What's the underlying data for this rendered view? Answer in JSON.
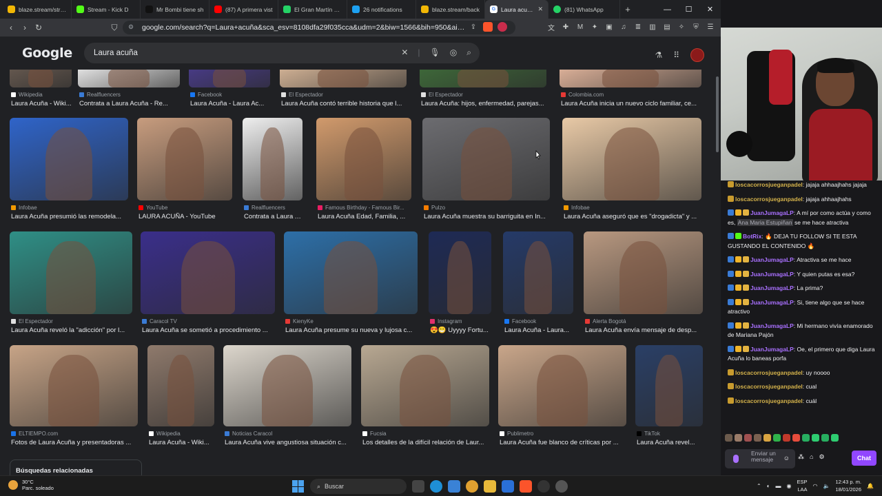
{
  "tabs": [
    {
      "title": "blaze.stream/strea",
      "color": "#f2b705"
    },
    {
      "title": "Stream - Kick D",
      "color": "#53fc18"
    },
    {
      "title": "Mr Bombi tiene sh",
      "color": "#111111"
    },
    {
      "title": "(87) A primera vist",
      "color": "#ff0000"
    },
    {
      "title": "El Gran Martín Eliz",
      "color": "#25d366"
    },
    {
      "title": "26 notifications",
      "color": "#1da1f2"
    },
    {
      "title": "blaze.stream/back",
      "color": "#f2b705"
    }
  ],
  "active_tab": {
    "title": "Laura acuña -",
    "close": "✕"
  },
  "whatsapp_tab": {
    "title": "(81) WhatsApp"
  },
  "new_tab_icon": "+",
  "window_controls": [
    "—",
    "☐",
    "✕"
  ],
  "url": "google.com/search?q=Laura+acuña&sca_esv=8108dfa29f035cca&udm=2&biw=1566&bih=950&aic=0&sxsrf=...",
  "google": {
    "logo": "Google",
    "query": "Laura acuña"
  },
  "rows": [
    [
      {
        "source": "Wikipedia",
        "caption": "Laura Acuña - Wiki...",
        "color": "#6a5c52",
        "sc": "#ffffff"
      },
      {
        "source": "Realfluencers",
        "caption": "Contrata a Laura Acuña - Re...",
        "color": "#efefef",
        "sc": "#3a7bd5"
      },
      {
        "source": "Facebook",
        "caption": "Laura Acuña - Laura Ac...",
        "color": "#4a3c8c",
        "sc": "#1877f2"
      },
      {
        "source": "El Espectador",
        "caption": "Laura Acuña contó terrible historia que l...",
        "color": "#d9b89a",
        "sc": "#e0e0e0"
      },
      {
        "source": "El Espectador",
        "caption": "Laura Acuña: hijos, enfermedad, parejas...",
        "color": "#3f6b3a",
        "sc": "#e0e0e0"
      },
      {
        "source": "Colombia.com",
        "caption": "Laura Acuña inicia un nuevo ciclo familiar, ce...",
        "color": "#e4b79e",
        "sc": "#e53935"
      }
    ],
    [
      {
        "source": "Infobae",
        "caption": "Laura Acuña presumió las remodela...",
        "color": "#2f64c9",
        "sc": "#f29900"
      },
      {
        "source": "YouTube",
        "caption": "LAURA ACUÑA - YouTube",
        "color": "#c79c7e",
        "sc": "#ff0000"
      },
      {
        "source": "Realfluencers",
        "caption": "Contrata a Laura A...",
        "color": "#eeeeee",
        "sc": "#3a7bd5"
      },
      {
        "source": "Famous Birthday - Famous Bir...",
        "caption": "Laura Acuña Edad, Familia, ...",
        "color": "#d19a6c",
        "sc": "#e91e63"
      },
      {
        "source": "Pulzo",
        "caption": "Laura Acuña muestra su barriguita en In...",
        "color": "#6c6c70",
        "sc": "#f57c00"
      },
      {
        "source": "Infobae",
        "caption": "Laura Acuña aseguró que es \"drogadicta\" y ...",
        "color": "#e8c9a6",
        "sc": "#f29900"
      }
    ],
    [
      {
        "source": "El Espectador",
        "caption": "Laura Acuña reveló la \"adicción\" por l...",
        "color": "#2f8f86",
        "sc": "#e0e0e0"
      },
      {
        "source": "Caracol TV",
        "caption": "Laura Acuña se sometió a procedimiento ...",
        "color": "#3a2e8a",
        "sc": "#3a7bd5"
      },
      {
        "source": "KienyKe",
        "caption": "Laura Acuña presume su nueva y lujosa c...",
        "color": "#2d6fa8",
        "sc": "#e53935"
      },
      {
        "source": "Instagram",
        "caption": "😍😁 Uyyyy Fortu...",
        "color": "#1e2a55",
        "sc": "#e1306c"
      },
      {
        "source": "Facebook",
        "caption": "Laura Acuña - Laura...",
        "color": "#253a68",
        "sc": "#1877f2"
      },
      {
        "source": "Alerta Bogotá",
        "caption": "Laura Acuña envía mensaje de desp...",
        "color": "#b89880",
        "sc": "#e53935"
      }
    ],
    [
      {
        "source": "ELTIEMPO.com",
        "caption": "Fotos de Laura Acuña y presentadoras ...",
        "color": "#c7a487",
        "sc": "#1a73e8"
      },
      {
        "source": "Wikipedia",
        "caption": "Laura Acuña - Wiki...",
        "color": "#8f7a6c",
        "sc": "#ffffff"
      },
      {
        "source": "Noticias Caracol",
        "caption": "Laura Acuña vive angustiosa situación c...",
        "color": "#dcd6cc",
        "sc": "#3a7bd5"
      },
      {
        "source": "Fucsia",
        "caption": "Los detalles de la difícil relación de Laur...",
        "color": "#b8a892",
        "sc": "#ffffff"
      },
      {
        "source": "Publimetro",
        "caption": "Laura Acuña fue blanco de críticas por ...",
        "color": "#c9a68a",
        "sc": "#ffffff"
      },
      {
        "source": "TikTok",
        "caption": "Laura Acuña revel...",
        "color": "#2a3f66",
        "sc": "#000000"
      }
    ]
  ],
  "related_label": "Búsquedas relacionadas",
  "taskbar": {
    "temp": "30°C",
    "weather": "Parc. soleado",
    "search": "Buscar",
    "lang1": "ESP",
    "lang2": "LAA",
    "time": "12:43 p. m.",
    "date": "18/01/2026"
  },
  "chat": {
    "messages": [
      {
        "user": "loscacorrosjueganpadel",
        "color": "#d4b24b",
        "text": ": jajaja ahhaajhahs jajaja",
        "badges": [
          "#c89b2e"
        ]
      },
      {
        "user": "loscacorrosjueganpadel",
        "color": "#d4b24b",
        "text": ": jajaja ahhaajhahs",
        "badges": [
          "#c89b2e"
        ]
      },
      {
        "user": "JuanJumagaLP",
        "color": "#a970ff",
        "text": ": A mí por como actúa y como es, ",
        "highlight": "Ana Maria Estupiñan",
        "text2": " se me hace atractiva",
        "badges": [
          "#3a7bd5",
          "#f0b429",
          "#e3b341"
        ]
      },
      {
        "user": "BotRix",
        "color": "#a970ff",
        "text": ": 🔥 DEJA TU FOLLOW SI TE ESTA GUSTANDO EL CONTENIDO 🔥",
        "badges": [
          "#3a7bd5",
          "#53fc18"
        ]
      },
      {
        "user": "JuanJumagaLP",
        "color": "#a970ff",
        "text": ": Atractiva se me hace",
        "badges": [
          "#3a7bd5",
          "#f0b429",
          "#e3b341"
        ]
      },
      {
        "user": "JuanJumagaLP",
        "color": "#a970ff",
        "text": ": Y quien putas es esa?",
        "badges": [
          "#3a7bd5",
          "#f0b429",
          "#e3b341"
        ]
      },
      {
        "user": "JuanJumagaLP",
        "color": "#a970ff",
        "text": ": La prima?",
        "badges": [
          "#3a7bd5",
          "#f0b429",
          "#e3b341"
        ]
      },
      {
        "user": "JuanJumagaLP",
        "color": "#a970ff",
        "text": ": Si, tiene algo que se hace atractivo",
        "badges": [
          "#3a7bd5",
          "#f0b429",
          "#e3b341"
        ]
      },
      {
        "user": "JuanJumagaLP",
        "color": "#a970ff",
        "text": ": Mi hermano vivía enamorado de Mariana Pajón",
        "badges": [
          "#3a7bd5",
          "#f0b429",
          "#e3b341"
        ]
      },
      {
        "user": "JuanJumagaLP",
        "color": "#a970ff",
        "text": ": Oe, el primero que diga Laura Acuña lo baneas porfa",
        "badges": [
          "#3a7bd5",
          "#f0b429",
          "#e3b341"
        ]
      },
      {
        "user": "loscacorrosjueganpadel",
        "color": "#d4b24b",
        "text": ": uy noooo",
        "badges": [
          "#c89b2e"
        ]
      },
      {
        "user": "loscacorrosjueganpadel",
        "color": "#d4b24b",
        "text": ": cual",
        "badges": [
          "#c89b2e"
        ]
      },
      {
        "user": "loscacorrosjueganpadel",
        "color": "#d4b24b",
        "text": ": cuál",
        "badges": [
          "#c89b2e"
        ]
      }
    ],
    "input_placeholder": "Enviar un mensaje",
    "send_label": "Chat"
  }
}
